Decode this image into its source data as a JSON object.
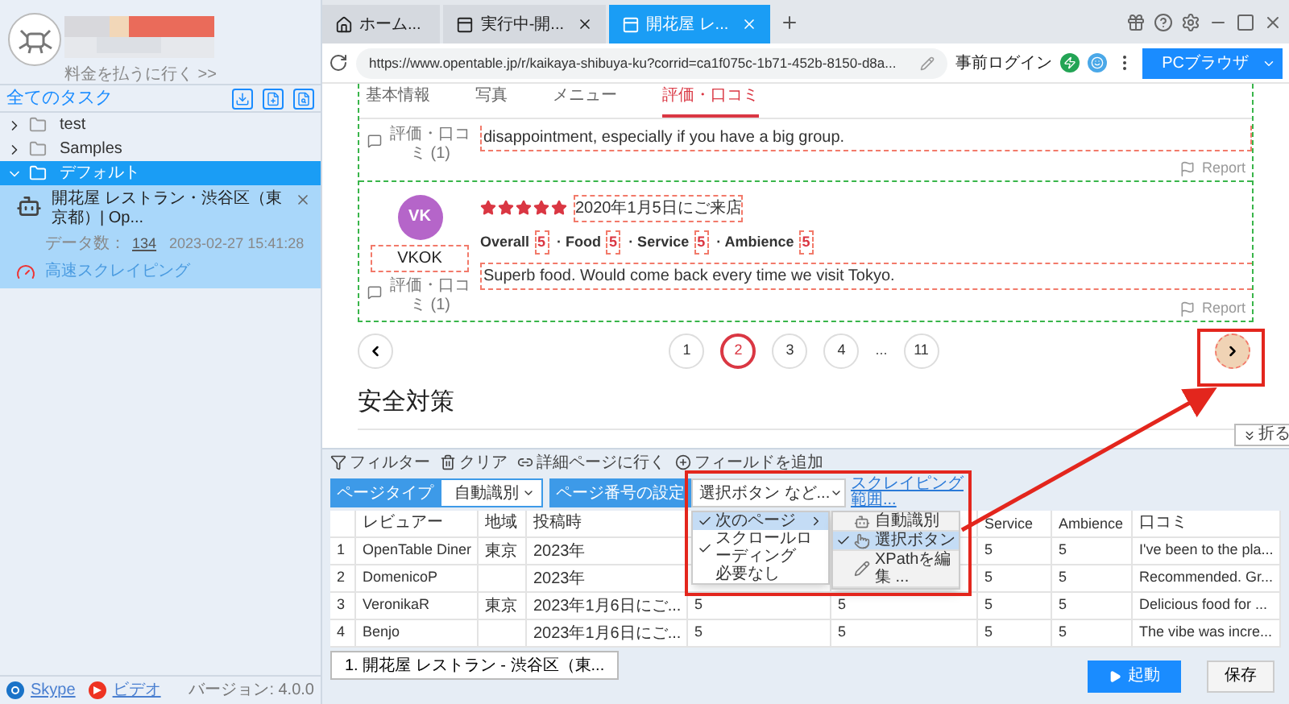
{
  "sidebar": {
    "pay_link": "料金を払うに行く >>",
    "all_tasks": "全てのタスク",
    "tree": [
      {
        "label": "test",
        "expanded": false,
        "selected": false
      },
      {
        "label": "Samples",
        "expanded": false,
        "selected": false
      },
      {
        "label": "デフォルト",
        "expanded": true,
        "selected": true,
        "children": [
          {
            "title": "開花屋 レストラン・渋谷区（東京都）| Op...",
            "data_label": "データ数：",
            "data_count": "134",
            "timestamp": "2023-02-27 15:41:28",
            "mode": "高速スクレイピング",
            "selected": true
          }
        ]
      }
    ],
    "footer": {
      "links": [
        {
          "kind": "skype",
          "label": "Skype"
        },
        {
          "kind": "video",
          "label": "ビデオ"
        }
      ],
      "version": "バージョン: 4.0.0"
    }
  },
  "browser": {
    "tabs": [
      {
        "kind": "home",
        "label": "ホーム...",
        "selected": false,
        "closable": false
      },
      {
        "kind": "page",
        "label": "実行中-開...",
        "selected": false,
        "closable": true
      },
      {
        "kind": "page",
        "label": "開花屋 レ...",
        "selected": true,
        "closable": true
      }
    ],
    "url": "https://www.opentable.jp/r/kaikaya-shibuya-ku?corrid=ca1f075c-1b71-452b-8150-d8a...",
    "pre_login": "事前ログイン",
    "mode_button": "PCブラウザ"
  },
  "page": {
    "nav": [
      {
        "label": "基本情報",
        "selected": false
      },
      {
        "label": "写真",
        "selected": false
      },
      {
        "label": "メニュー",
        "selected": false
      },
      {
        "label": "評価・口コミ",
        "selected": true
      }
    ],
    "reviews": [
      {
        "review_count": "評価・口コミ (1)",
        "text": "disappointment, especially if you have a big group.",
        "report": "Report"
      },
      {
        "avatar_initials": "VK",
        "name": "VKOK",
        "review_count": "評価・口コミ (1)",
        "stars": 5,
        "visit_date": "2020年1月5日にご来店",
        "ratings": [
          {
            "label": "Overall",
            "value": "5"
          },
          {
            "label": "· Food",
            "value": "5"
          },
          {
            "label": "· Service",
            "value": "5"
          },
          {
            "label": "· Ambience",
            "value": "5"
          }
        ],
        "text": "Superb food. Would come back every time we visit Tokyo.",
        "report": "Report"
      }
    ],
    "pagination": {
      "pages": [
        {
          "label": "1",
          "selected": false
        },
        {
          "label": "2",
          "selected": true
        },
        {
          "label": "3",
          "selected": false
        },
        {
          "label": "4",
          "selected": false
        },
        {
          "label": "...",
          "selected": false,
          "kind": "ellipsis"
        },
        {
          "label": "11",
          "selected": false
        }
      ]
    },
    "section_heading": "安全対策"
  },
  "extractor": {
    "collapse": "折る",
    "page_type": {
      "label": "ページタイプ",
      "value": "自動識別"
    },
    "page_number": {
      "label": "ページ番号の設定",
      "value": "選択ボタン など..."
    },
    "scope_link": "スクレイピング範囲...",
    "actions": [
      {
        "kind": "filter",
        "label": "フィルター"
      },
      {
        "kind": "clear",
        "label": "クリア"
      },
      {
        "kind": "detail",
        "label": "詳細ページに行く"
      },
      {
        "kind": "add",
        "label": "フィールドを追加"
      }
    ],
    "menu": [
      {
        "label": "次のページ",
        "checked": true,
        "selected": true,
        "has_submenu": true
      },
      {
        "label": "スクロールローディング",
        "checked": true,
        "selected": false,
        "has_submenu": false
      },
      {
        "label": "必要なし",
        "checked": false,
        "selected": false,
        "has_submenu": false
      }
    ],
    "submenu": [
      {
        "kind": "auto",
        "label": "自動識別",
        "checked": false,
        "selected": false
      },
      {
        "kind": "click",
        "label": "選択ボタン",
        "checked": true,
        "selected": true
      },
      {
        "kind": "xpath",
        "label": "XPathを編集 ...",
        "checked": false,
        "selected": false
      }
    ],
    "table": {
      "columns": [
        null,
        "レビュアー",
        "地域",
        "投稿時",
        null,
        null,
        "Service",
        "Ambience",
        "口コミ"
      ],
      "rows": [
        [
          "1",
          "OpenTable Diner",
          "東京",
          "2023年",
          null,
          null,
          "5",
          "5",
          "I've been to the pla..."
        ],
        [
          "2",
          "DomenicoP",
          null,
          "2023年",
          null,
          null,
          "5",
          "5",
          "Recommended. Gr..."
        ],
        [
          "3",
          "VeronikaR",
          "東京",
          "2023年1月6日にご...",
          "5",
          "5",
          "5",
          "5",
          "Delicious food for ..."
        ],
        [
          "4",
          "Benjo",
          null,
          "2023年1月6日にご...",
          "5",
          "5",
          "5",
          "5",
          "The vibe was incre..."
        ]
      ]
    }
  },
  "bottom": {
    "run_tab": "1. 開花屋 レストラン - 渋谷区（東...",
    "start": "起動",
    "save": "保存"
  }
}
